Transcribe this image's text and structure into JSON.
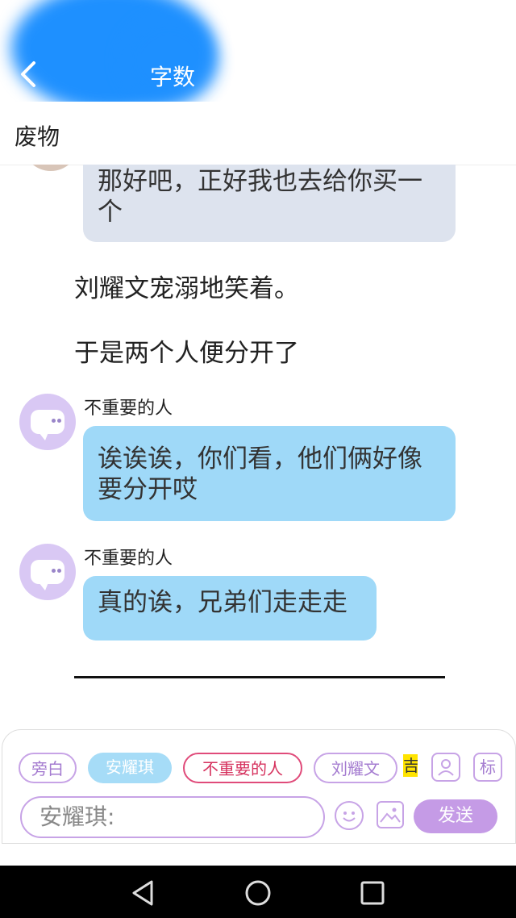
{
  "header": {
    "title": "字数"
  },
  "subbar": {
    "label": "废物"
  },
  "chat": {
    "first_bubble": "那好吧，正好我也去给你买一个",
    "narration_1": "刘耀文宠溺地笑着。",
    "narration_2": "于是两个人便分开了",
    "msg1": {
      "name": "不重要的人",
      "text": "诶诶诶，你们看，他们俩好像要分开哎"
    },
    "msg2": {
      "name": "不重要的人",
      "text": "真的诶，兄弟们走走走"
    }
  },
  "composer": {
    "chips": [
      "旁白",
      "安耀琪",
      "不重要的人",
      "刘耀文"
    ],
    "partial_chip": "吉",
    "tag_button": "标",
    "input_value": "安耀琪:",
    "send_label": "发送"
  },
  "colors": {
    "accent": "#c59be6",
    "bubble_blue": "#9fd9f8",
    "bubble_gray": "#dde3ee",
    "chip_pink": "#e04b7a"
  }
}
